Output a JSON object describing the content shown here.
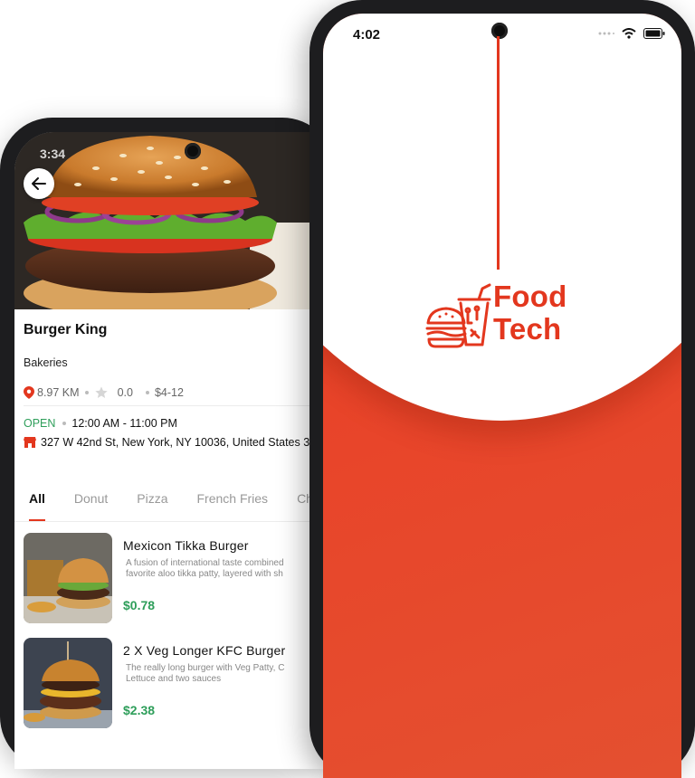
{
  "right_phone": {
    "status": {
      "time": "4:02"
    },
    "logo": {
      "line1": "Food",
      "line2": "Tech"
    },
    "colors": {
      "brand": "#e3371e",
      "background_red": "#e8452a"
    }
  },
  "left_phone": {
    "status": {
      "time": "3:34"
    },
    "restaurant": {
      "name": "Burger King",
      "category": "Bakeries",
      "distance": "8.97 KM",
      "rating": "0.0",
      "price_range": "$4-12",
      "status": "OPEN",
      "hours": "12:00 AM - 11:00 PM",
      "address": "327 W 42nd St, New York, NY 10036, United States 3"
    },
    "tabs": [
      "All",
      "Donut",
      "Pizza",
      "French Fries",
      "Chic"
    ],
    "menu_items": [
      {
        "title": "Mexicon Tikka Burger",
        "desc_line1": "A fusion of international taste combined",
        "desc_line2": "favorite aloo tikka patty, layered with sh",
        "price": "$0.78"
      },
      {
        "title": "2 X Veg Longer KFC Burger",
        "desc_line1": "The really long burger with Veg Patty, C",
        "desc_line2": "Lettuce and two sauces",
        "price": "$2.38"
      }
    ],
    "colors": {
      "open": "#2e9e5a",
      "price": "#2e9e5a",
      "accent": "#e3371e"
    }
  }
}
